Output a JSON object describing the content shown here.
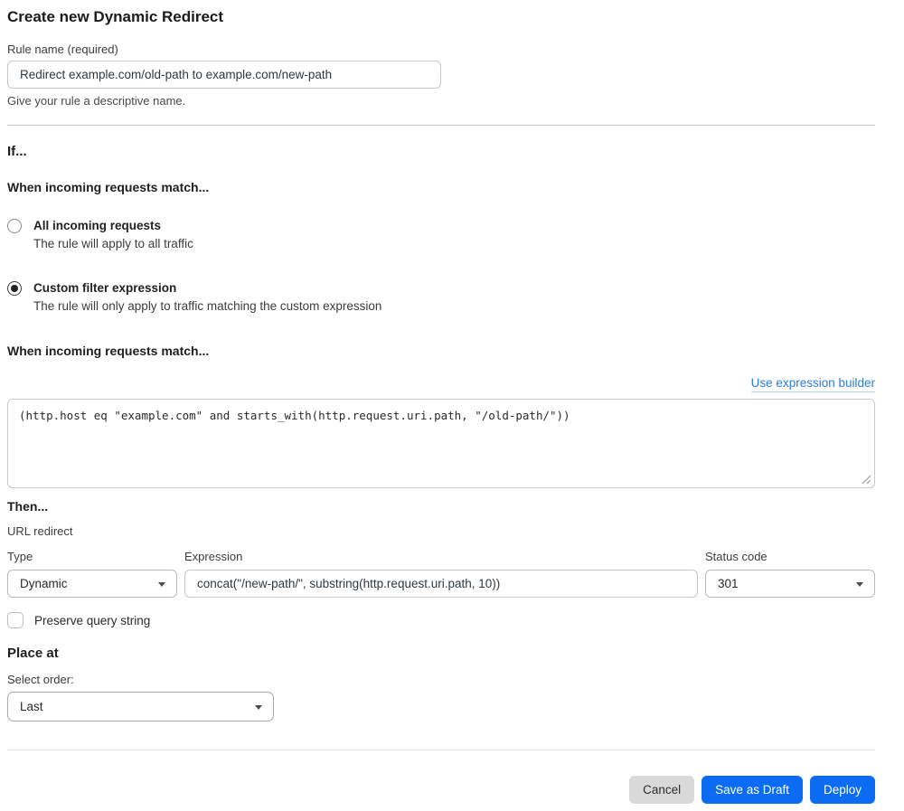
{
  "page": {
    "title": "Create new Dynamic Redirect"
  },
  "rule_name": {
    "label": "Rule name (required)",
    "value": "Redirect example.com/old-path to example.com/new-path",
    "help": "Give your rule a descriptive name."
  },
  "if_section": {
    "heading": "If...",
    "subheading": "When incoming requests match...",
    "options": [
      {
        "label": "All incoming requests",
        "description": "The rule will apply to all traffic",
        "selected": false
      },
      {
        "label": "Custom filter expression",
        "description": "The rule will only apply to traffic matching the custom expression",
        "selected": true
      }
    ]
  },
  "expression_section": {
    "heading": "When incoming requests match...",
    "builder_link": "Use expression builder",
    "value": "(http.host eq \"example.com\" and starts_with(http.request.uri.path, \"/old-path/\"))"
  },
  "then_section": {
    "heading": "Then...",
    "action_label": "URL redirect",
    "type": {
      "label": "Type",
      "value": "Dynamic"
    },
    "expression": {
      "label": "Expression",
      "value": "concat(\"/new-path/\", substring(http.request.uri.path, 10))"
    },
    "status_code": {
      "label": "Status code",
      "value": "301"
    },
    "preserve_query_label": "Preserve query string"
  },
  "place_at": {
    "heading": "Place at",
    "label": "Select order:",
    "value": "Last"
  },
  "footer": {
    "cancel_label": "Cancel",
    "save_draft_label": "Save as Draft",
    "deploy_label": "Deploy"
  },
  "colors": {
    "primary_blue": "#0b6cf3",
    "link_blue": "#2c7cd9"
  }
}
